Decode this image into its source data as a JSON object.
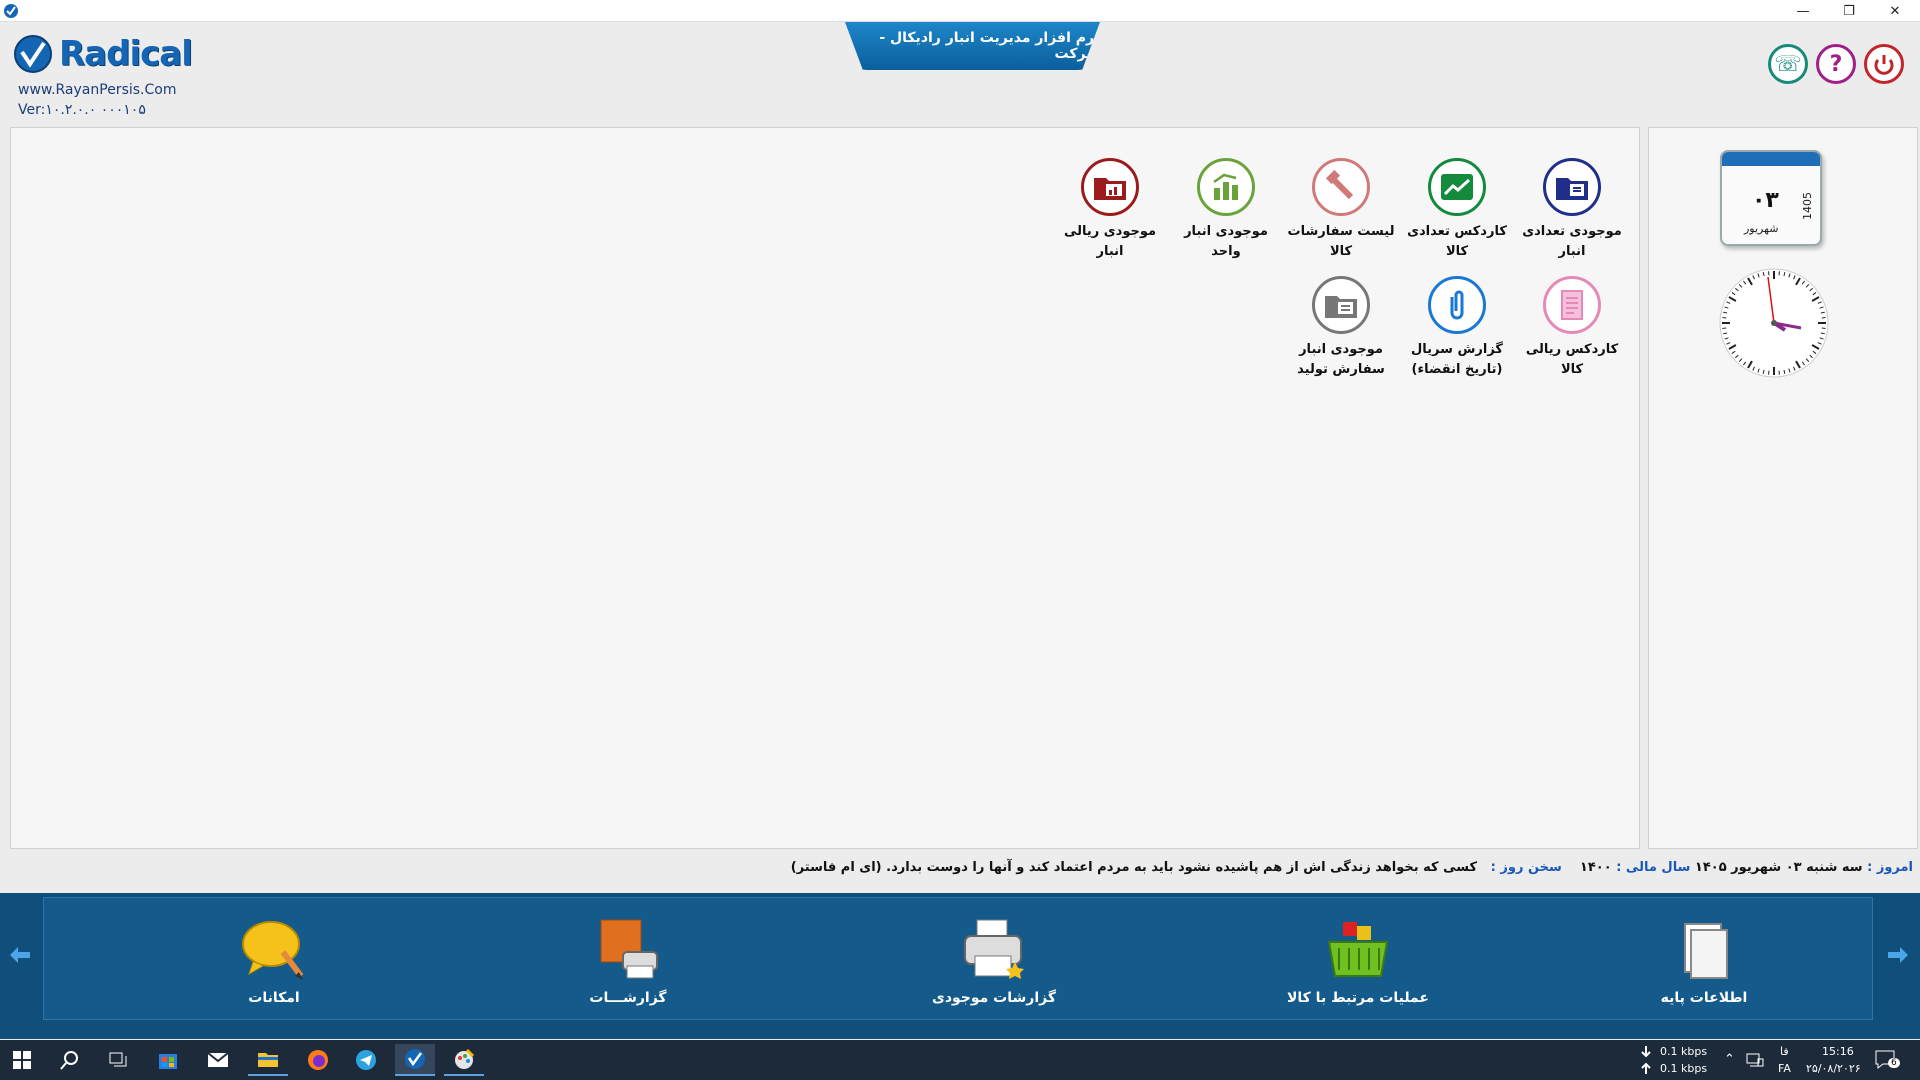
{
  "window": {
    "minimize": "—",
    "restore": "❐",
    "close": "✕"
  },
  "header": {
    "logo_text": "Radical",
    "site_url": "www.RayanPersis.Com",
    "version": "Ver:۱۰.۲.۰.۰   ۰۰۰۱۰۵",
    "app_title": "نرم افزار مدیریت انبار رادیکال - شرکت",
    "top_icons": [
      "phone-icon",
      "help-icon",
      "exit-icon"
    ],
    "phone_glyph": "☏",
    "help_glyph": "?"
  },
  "shortcuts": [
    {
      "label": "موجودی تعدادی انبار",
      "icon": "folder-doc-icon",
      "color": "#1f2f8a"
    },
    {
      "label": "کاردکس تعدادی کالا",
      "icon": "trend-chart-icon",
      "color": "#138a3c"
    },
    {
      "label": "لیست سفارشات کالا",
      "icon": "hammer-icon",
      "color": "#d07a7a"
    },
    {
      "label": "موجودی انبار  واحد",
      "icon": "bar-chart-icon",
      "color": "#6aa33a"
    },
    {
      "label": "موجودی ریالی انبار",
      "icon": "folder-chart-icon",
      "color": "#9a1c1c"
    },
    {
      "label": "کاردکس ریالی کالا",
      "icon": "document-icon",
      "color": "#e58ab8"
    },
    {
      "label": "گزارش سریال (تاریخ انقضاء)",
      "icon": "paperclip-icon",
      "color": "#1a78d4"
    },
    {
      "label": "موجودی انبار سفارش تولید",
      "icon": "folder-gray-icon",
      "color": "#777777"
    }
  ],
  "calendar": {
    "day": "۰۳",
    "month": "شهریور",
    "year": "1405"
  },
  "clock": {
    "time": "15:16"
  },
  "status": {
    "today_label": "امروز :",
    "today_value": "سه شنبه ۰۳ شهریور ۱۴۰۵",
    "fiscal_label": "سال مالی :",
    "fiscal_value": "۱۴۰۰",
    "quote_label": "سخن روز :",
    "quote_value": "کسی که بخواهد زندگی اش از هم پاشیده نشود باید به مردم اعتماد کند و آنها را دوست بدارد. (ای ام فاستر)"
  },
  "toolbar": {
    "items": [
      {
        "label": "اطلاعات پایه",
        "icon": "documents-icon"
      },
      {
        "label": "عملیات مرتبط با کالا",
        "icon": "basket-icon"
      },
      {
        "label": "گزارشات موجودی",
        "icon": "printer-star-icon"
      },
      {
        "label": "گزارشـــات",
        "icon": "printer-report-icon"
      },
      {
        "label": "امکانات",
        "icon": "speech-pencil-icon"
      }
    ]
  },
  "taskbar": {
    "net_down": "0.1 kbps",
    "net_up": "0.1 kbps",
    "lang_top": "فا",
    "lang_bottom": "FA",
    "time": "15:16",
    "date": "۲۵/۰۸/۲۰۲۶",
    "notification_count": "6"
  },
  "colors": {
    "toolbar_bg": "#104f7b",
    "accent": "#1565b5",
    "taskbar": "#1c2a3a"
  }
}
